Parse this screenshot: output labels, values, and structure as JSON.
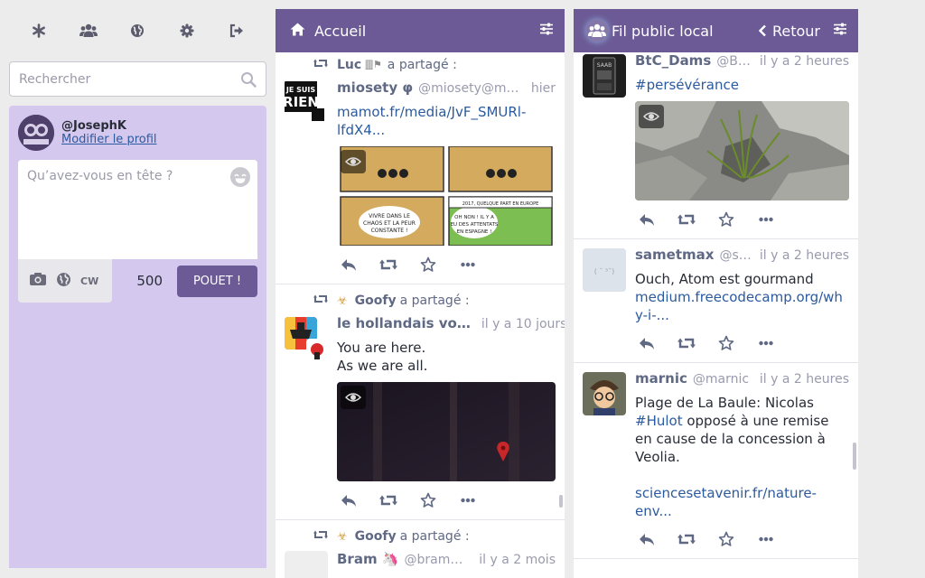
{
  "drawer": {
    "tabs": [
      {
        "name": "getting-started",
        "icon": "asterisk-icon"
      },
      {
        "name": "local-timeline",
        "icon": "users-icon"
      },
      {
        "name": "federated-timeline",
        "icon": "globe-icon"
      },
      {
        "name": "preferences",
        "icon": "gear-icon"
      },
      {
        "name": "logout",
        "icon": "sign-out-icon"
      }
    ],
    "search": {
      "placeholder": "Rechercher"
    },
    "profile": {
      "handle": "@JosephK",
      "edit_label": "Modifier le profil"
    },
    "compose": {
      "placeholder": "Qu’avez-vous en tête ?",
      "cw_label": "CW",
      "char_count": "500",
      "toot_label": "POUET !"
    }
  },
  "home_column": {
    "title": "Accueil",
    "statuses": [
      {
        "reblogger": "Luc",
        "reblogger_badge": "🀫⚑",
        "reblog_label": "a partagé :",
        "display_name": "miosety φ",
        "acct": "@miosety@ma…",
        "time": "hier",
        "link_lines": [
          "mamot.fr/media/JvF_SMURl-",
          "lfdX4..."
        ],
        "avatar_text": "JE SUIS RIEN",
        "comic": {
          "panel_3": "VIVRE DANS LE CHAOS ET LA PEUR CONSTANTE !",
          "panel_2_caption": "2017, QUELQUE PART EN EUROPE",
          "panel_4": "OH NON ! IL Y A EU DES ATTENTATS EN ESPAGNE !"
        }
      },
      {
        "reblogger": "Goofy",
        "reblogger_badge": "☣",
        "reblog_label": "a partagé :",
        "display_name": "le hollandais vo…",
        "acct": "",
        "time": "il y a 10 jours",
        "text_lines": [
          "You are here.",
          "As we are all."
        ]
      },
      {
        "reblogger": "Goofy",
        "reblogger_badge": "☣",
        "reblog_label": "a partagé :",
        "display_name": "Bram 🦄",
        "acct": "@bram@…",
        "time": "il y a 2 mois"
      }
    ]
  },
  "public_column": {
    "title": "Fil public local",
    "back_label": "Retour",
    "statuses": [
      {
        "display_name": "BtC_Dams",
        "acct": "@Bt…",
        "time": "il y a 2 heures",
        "hashtag": "#persévérance",
        "avatar_text": "SAAB"
      },
      {
        "display_name": "sametmax",
        "acct": "@sa…",
        "time": "il y a 2 heures",
        "text": "Ouch, Atom est gourmand",
        "link_lines": [
          "medium.freecodecamp.org/wh",
          "y-i-..."
        ]
      },
      {
        "display_name": "marnic",
        "acct": "@marnic",
        "time": "il y a 2 heures",
        "text_before": "Plage de La Baule: Nicolas",
        "hashtag": "#Hulot",
        "text_after_lines": [
          " opposé à une remise",
          "en cause de la concession à",
          "Veolia."
        ],
        "link_lines": [
          "sciencesetavenir.fr/nature-",
          "env..."
        ]
      }
    ]
  },
  "colors": {
    "accent": "#6b5a95",
    "drawer_bg": "#d5c8ee",
    "link": "#2b5a9e",
    "muted": "#606984"
  }
}
